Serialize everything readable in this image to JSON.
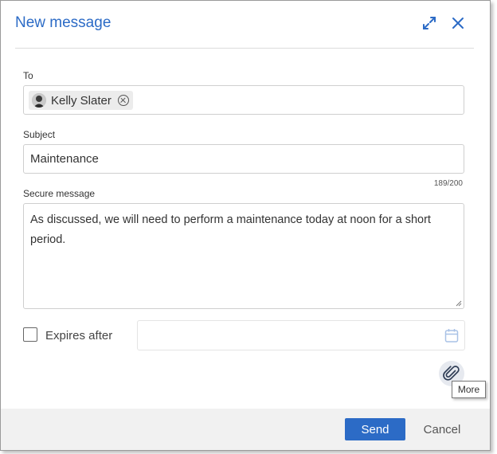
{
  "dialog": {
    "title": "New message",
    "expand_icon": "expand-icon",
    "close_icon": "close-icon"
  },
  "to": {
    "label": "To",
    "recipients": [
      {
        "name": "Kelly Slater",
        "avatar": "avatar-photo"
      }
    ]
  },
  "subject": {
    "label": "Subject",
    "value": "Maintenance",
    "counter": "189/200"
  },
  "message": {
    "label": "Secure message",
    "value": "As discussed, we will need to perform a maintenance today at noon for a short period."
  },
  "expires": {
    "label": "Expires after",
    "checked": false,
    "date_value": "",
    "calendar_icon": "calendar-icon"
  },
  "attach": {
    "icon": "paperclip-icon",
    "tooltip": "More"
  },
  "footer": {
    "send_label": "Send",
    "cancel_label": "Cancel"
  },
  "colors": {
    "accent": "#2c6bc6",
    "footer_bg": "#f1f1f1"
  }
}
